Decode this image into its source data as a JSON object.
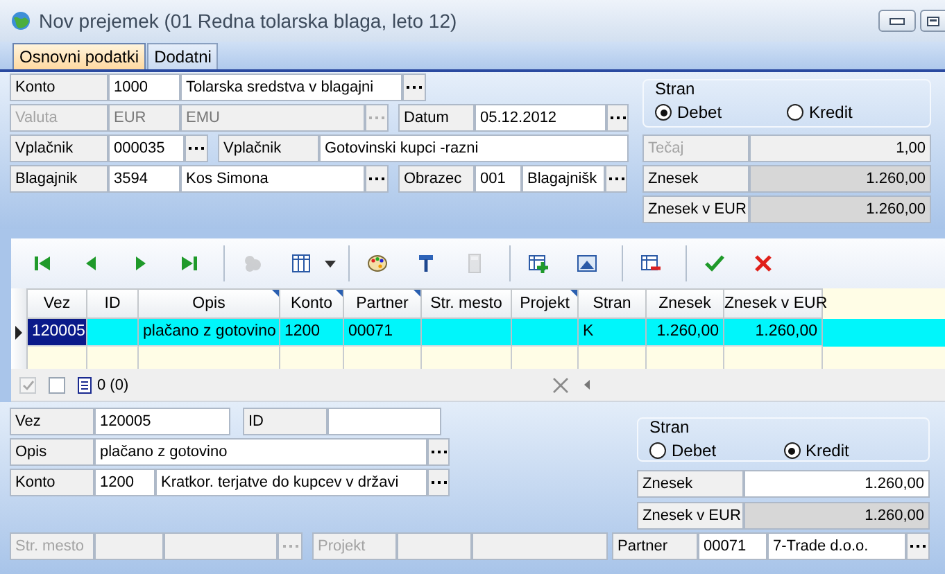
{
  "window": {
    "title": "Nov prejemek (01 Redna tolarska blaga, leto 12)"
  },
  "tabs": [
    {
      "label": "Osnovni podatki",
      "selected": true
    },
    {
      "label": "Dodatni",
      "selected": false
    }
  ],
  "header": {
    "konto": {
      "label": "Konto",
      "code": "1000",
      "name": "Tolarska sredstva v blagajni",
      "disabled": false
    },
    "valuta": {
      "label": "Valuta",
      "code": "EUR",
      "name": "EMU",
      "disabled": true
    },
    "datum": {
      "label": "Datum",
      "value": "05.12.2012",
      "disabled": false
    },
    "vplacnik": {
      "label": "Vplačnik",
      "code": "000035",
      "disabled": false
    },
    "vplacnik_naziv": {
      "label": "Vplačnik",
      "value": "Gotovinski kupci -razni",
      "disabled": false
    },
    "blagajnik": {
      "label": "Blagajnik",
      "code": "3594",
      "name": "Kos Simona",
      "disabled": false
    },
    "obrazec": {
      "label": "Obrazec",
      "code": "001",
      "name": "Blagajnišk",
      "disabled": false
    },
    "stran": {
      "title": "Stran",
      "options": [
        {
          "label": "Debet",
          "selected": true
        },
        {
          "label": "Kredit",
          "selected": false
        }
      ]
    },
    "amounts": [
      {
        "label": "Tečaj",
        "value": "1,00",
        "kind": "disabled"
      },
      {
        "label": "Znesek",
        "value": "1.260,00",
        "kind": "readonly"
      },
      {
        "label": "Znesek v EUR",
        "value": "1.260,00",
        "kind": "readonly"
      }
    ]
  },
  "toolbar": {
    "groups": [
      [
        {
          "kind": "first",
          "disabled": false
        },
        {
          "kind": "previous",
          "disabled": false
        },
        {
          "kind": "next",
          "disabled": false
        },
        {
          "kind": "last",
          "disabled": false
        }
      ],
      [
        {
          "kind": "shape",
          "disabled": true
        },
        {
          "kind": "columns",
          "disabled": false
        }
      ],
      [
        {
          "kind": "palette",
          "disabled": false
        },
        {
          "kind": "hammer",
          "disabled": false
        },
        {
          "kind": "calculator",
          "disabled": true
        }
      ],
      [
        {
          "kind": "add_row",
          "disabled": false
        },
        {
          "kind": "image",
          "disabled": false
        }
      ],
      [
        {
          "kind": "delete_row",
          "disabled": false
        }
      ],
      [
        {
          "kind": "confirm",
          "disabled": false
        },
        {
          "kind": "cancel",
          "disabled": false
        }
      ]
    ]
  },
  "table": {
    "columns": [
      {
        "label": "Vez",
        "marked": false,
        "kind": "text"
      },
      {
        "label": "ID",
        "marked": false,
        "kind": "text"
      },
      {
        "label": "Opis",
        "marked": true,
        "kind": "text"
      },
      {
        "label": "Konto",
        "marked": true,
        "kind": "text"
      },
      {
        "label": "Partner",
        "marked": true,
        "kind": "text"
      },
      {
        "label": "Str. mesto",
        "marked": false,
        "kind": "text"
      },
      {
        "label": "Projekt",
        "marked": true,
        "kind": "text"
      },
      {
        "label": "Stran",
        "marked": false,
        "kind": "text"
      },
      {
        "label": "Znesek",
        "marked": false,
        "kind": "number"
      },
      {
        "label": "Znesek v EUR",
        "marked": false,
        "kind": "number"
      }
    ],
    "rows": [
      {
        "selected": true,
        "cells": [
          {
            "text": "120005",
            "focused": true
          },
          {
            "focused": false
          },
          {
            "text": "plačano z gotovino",
            "focused": false
          },
          {
            "text": "1200",
            "focused": false
          },
          {
            "text": "00071",
            "focused": false
          },
          {
            "focused": false
          },
          {
            "focused": false
          },
          {
            "text": "K",
            "focused": false
          },
          {
            "text": "1.260,00",
            "focused": false
          },
          {
            "text": "1.260,00",
            "focused": false
          }
        ]
      }
    ]
  },
  "status_bar": {
    "checkboxes": [
      {
        "checked": true,
        "disabled": true
      },
      {
        "checked": false,
        "disabled": false
      }
    ],
    "count": "0 (0)"
  },
  "detail": {
    "vez": {
      "label": "Vez",
      "value": "120005",
      "disabled": false
    },
    "id": {
      "label": "ID",
      "disabled": false
    },
    "opis": {
      "label": "Opis",
      "value": "plačano z gotovino",
      "disabled": false
    },
    "konto": {
      "label": "Konto",
      "code": "1200",
      "name": "Kratkor. terjatve do kupcev v državi",
      "disabled": false
    },
    "stran": {
      "title": "Stran",
      "options": [
        {
          "label": "Debet",
          "selected": false
        },
        {
          "label": "Kredit",
          "selected": true
        }
      ]
    },
    "amounts": [
      {
        "label": "Znesek",
        "value": "1.260,00",
        "kind": "editable"
      },
      {
        "label": "Znesek v EUR",
        "value": "1.260,00",
        "kind": "readonly"
      }
    ],
    "str_mesto": {
      "label": "Str. mesto",
      "disabled": true
    },
    "projekt": {
      "label": "Projekt",
      "disabled": true
    },
    "partner": {
      "label": "Partner",
      "code": "00071",
      "name": "7-Trade d.o.o.",
      "disabled": false
    }
  }
}
